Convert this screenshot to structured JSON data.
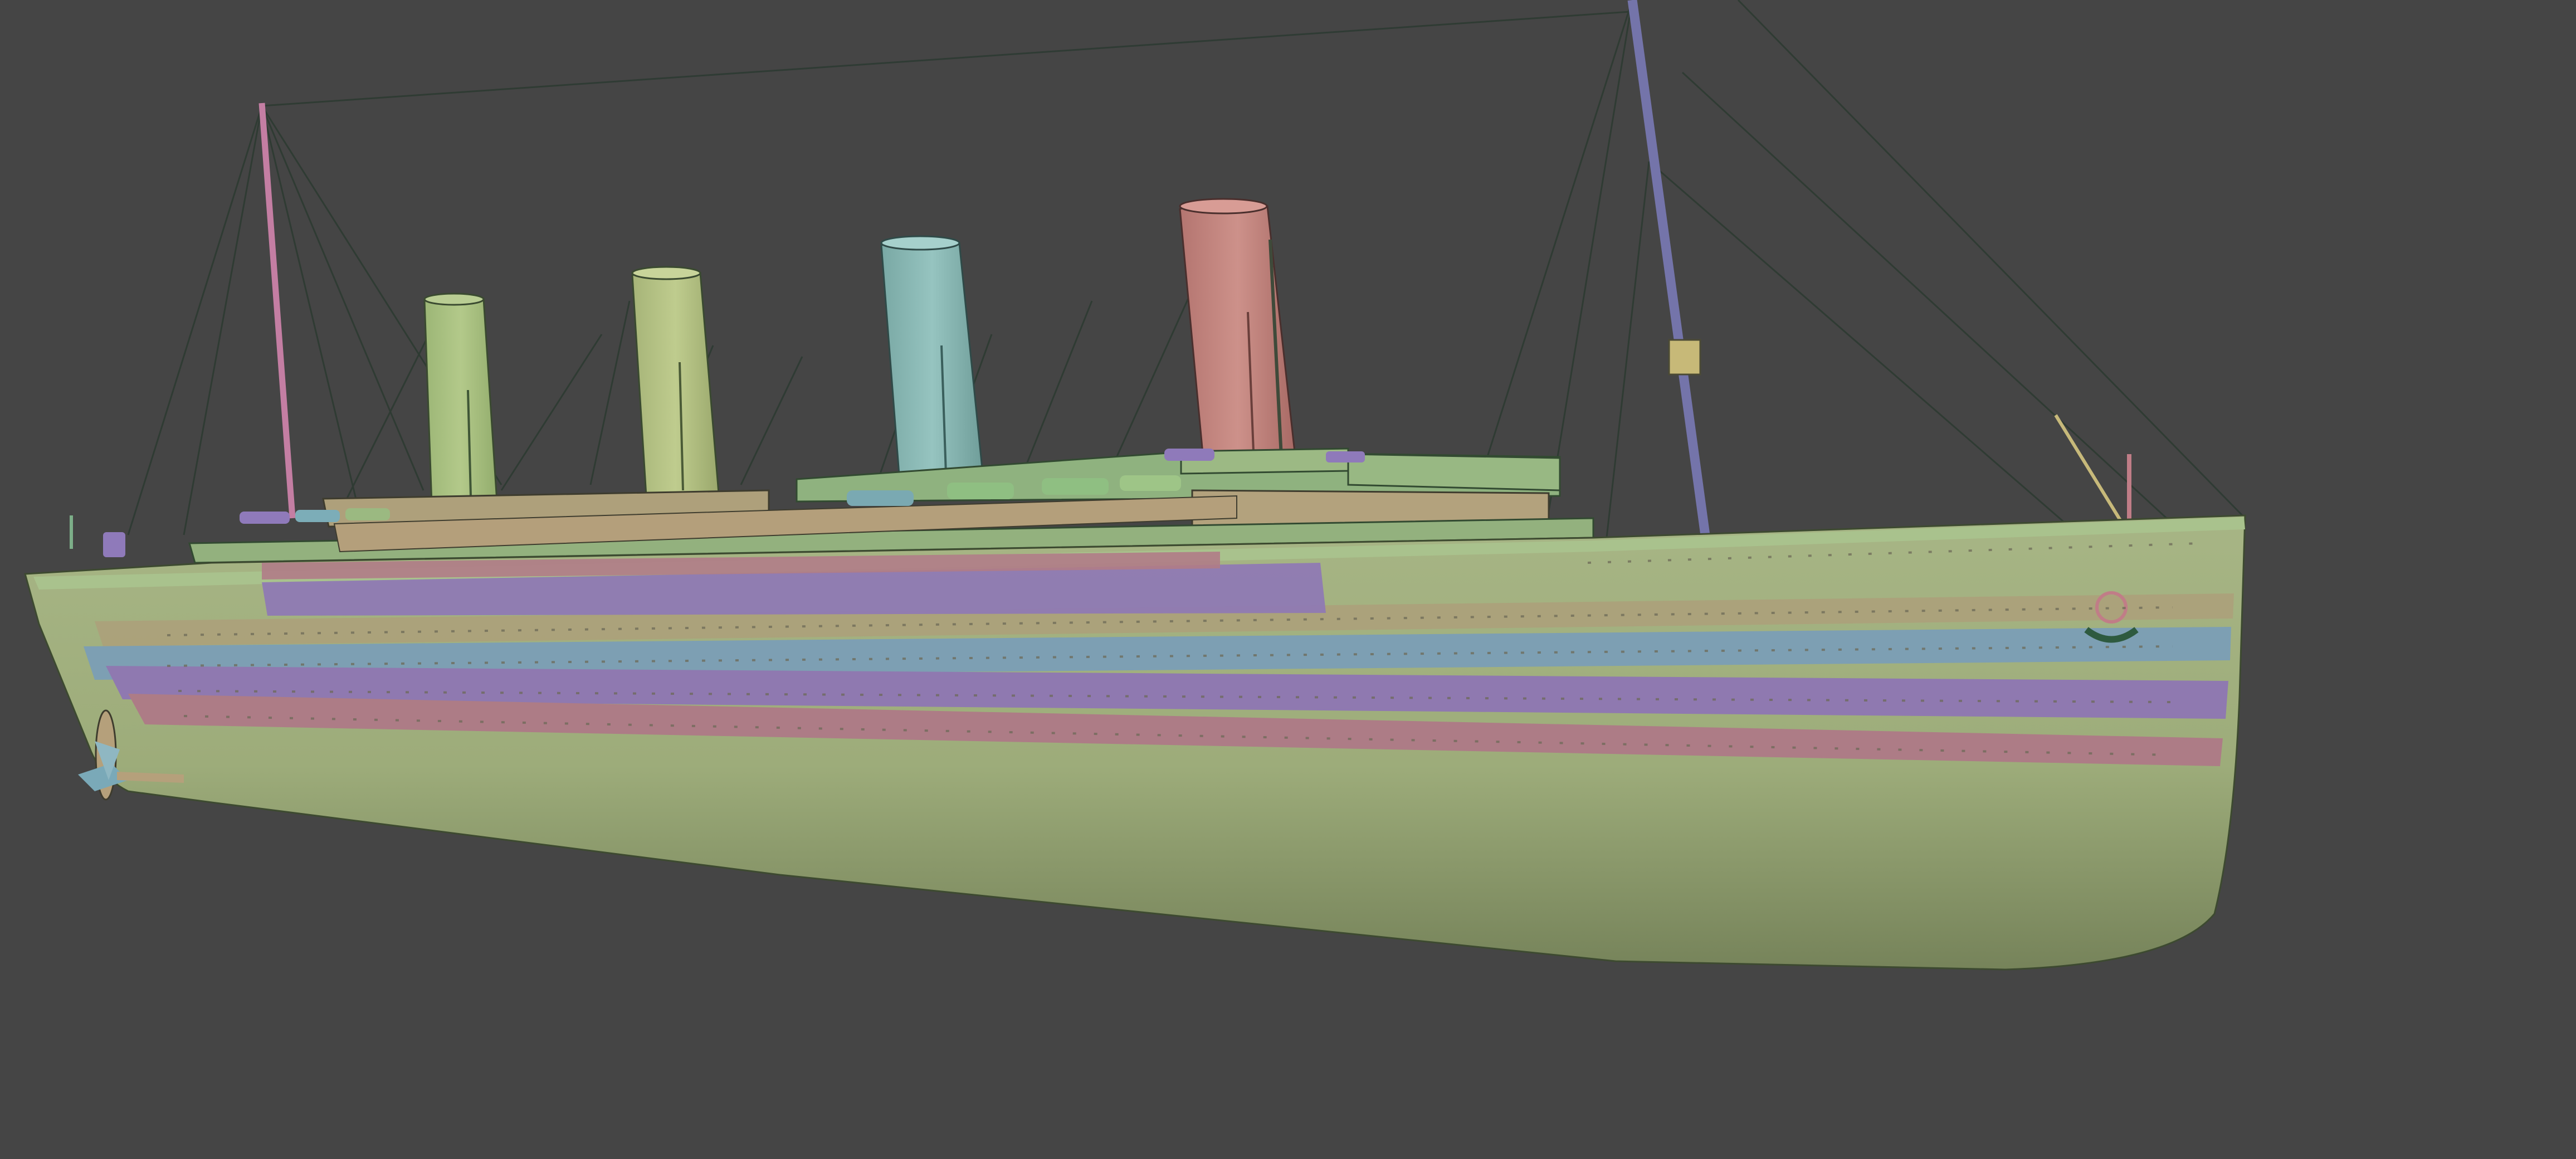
{
  "viewport": {
    "mode": "3d-solid-view",
    "background_color": "#454545"
  },
  "scene": {
    "object_kind": "ocean-liner-model",
    "funnel_count": 4,
    "mast_count": 2,
    "palette": {
      "hull": "#9fae7c",
      "hull_shadow": "#7f8c5f",
      "deck": "#93b07e",
      "band_pink": "#b07c87",
      "band_purple": "#8e79b1",
      "band_blue": "#7c9fb5",
      "band_tan": "#aca27c",
      "funnel_1": "#a8c080",
      "funnel_2": "#b3c183",
      "funnel_3": "#86b5b1",
      "funnel_4": "#c1847e",
      "mast_fore": "#7b7bb3",
      "mast_aft": "#c481a4",
      "rigging": "#2f3b31"
    }
  }
}
